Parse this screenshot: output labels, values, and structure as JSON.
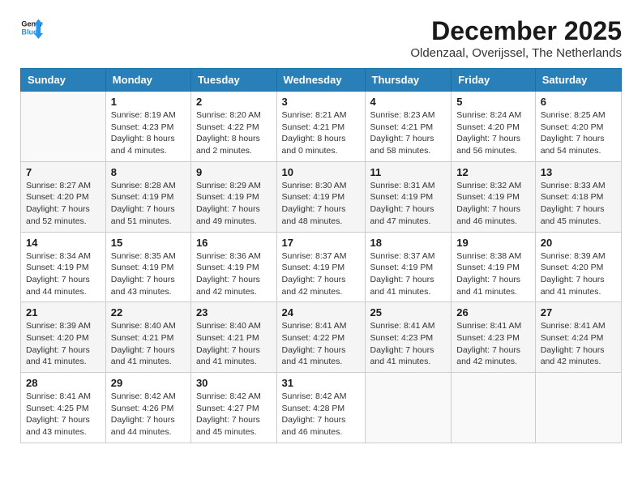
{
  "logo": {
    "line1": "General",
    "line2": "Blue"
  },
  "header": {
    "month": "December 2025",
    "location": "Oldenzaal, Overijssel, The Netherlands"
  },
  "weekdays": [
    "Sunday",
    "Monday",
    "Tuesday",
    "Wednesday",
    "Thursday",
    "Friday",
    "Saturday"
  ],
  "weeks": [
    [
      {
        "day": "",
        "info": ""
      },
      {
        "day": "1",
        "info": "Sunrise: 8:19 AM\nSunset: 4:23 PM\nDaylight: 8 hours\nand 4 minutes."
      },
      {
        "day": "2",
        "info": "Sunrise: 8:20 AM\nSunset: 4:22 PM\nDaylight: 8 hours\nand 2 minutes."
      },
      {
        "day": "3",
        "info": "Sunrise: 8:21 AM\nSunset: 4:21 PM\nDaylight: 8 hours\nand 0 minutes."
      },
      {
        "day": "4",
        "info": "Sunrise: 8:23 AM\nSunset: 4:21 PM\nDaylight: 7 hours\nand 58 minutes."
      },
      {
        "day": "5",
        "info": "Sunrise: 8:24 AM\nSunset: 4:20 PM\nDaylight: 7 hours\nand 56 minutes."
      },
      {
        "day": "6",
        "info": "Sunrise: 8:25 AM\nSunset: 4:20 PM\nDaylight: 7 hours\nand 54 minutes."
      }
    ],
    [
      {
        "day": "7",
        "info": "Sunrise: 8:27 AM\nSunset: 4:20 PM\nDaylight: 7 hours\nand 52 minutes."
      },
      {
        "day": "8",
        "info": "Sunrise: 8:28 AM\nSunset: 4:19 PM\nDaylight: 7 hours\nand 51 minutes."
      },
      {
        "day": "9",
        "info": "Sunrise: 8:29 AM\nSunset: 4:19 PM\nDaylight: 7 hours\nand 49 minutes."
      },
      {
        "day": "10",
        "info": "Sunrise: 8:30 AM\nSunset: 4:19 PM\nDaylight: 7 hours\nand 48 minutes."
      },
      {
        "day": "11",
        "info": "Sunrise: 8:31 AM\nSunset: 4:19 PM\nDaylight: 7 hours\nand 47 minutes."
      },
      {
        "day": "12",
        "info": "Sunrise: 8:32 AM\nSunset: 4:19 PM\nDaylight: 7 hours\nand 46 minutes."
      },
      {
        "day": "13",
        "info": "Sunrise: 8:33 AM\nSunset: 4:18 PM\nDaylight: 7 hours\nand 45 minutes."
      }
    ],
    [
      {
        "day": "14",
        "info": "Sunrise: 8:34 AM\nSunset: 4:19 PM\nDaylight: 7 hours\nand 44 minutes."
      },
      {
        "day": "15",
        "info": "Sunrise: 8:35 AM\nSunset: 4:19 PM\nDaylight: 7 hours\nand 43 minutes."
      },
      {
        "day": "16",
        "info": "Sunrise: 8:36 AM\nSunset: 4:19 PM\nDaylight: 7 hours\nand 42 minutes."
      },
      {
        "day": "17",
        "info": "Sunrise: 8:37 AM\nSunset: 4:19 PM\nDaylight: 7 hours\nand 42 minutes."
      },
      {
        "day": "18",
        "info": "Sunrise: 8:37 AM\nSunset: 4:19 PM\nDaylight: 7 hours\nand 41 minutes."
      },
      {
        "day": "19",
        "info": "Sunrise: 8:38 AM\nSunset: 4:19 PM\nDaylight: 7 hours\nand 41 minutes."
      },
      {
        "day": "20",
        "info": "Sunrise: 8:39 AM\nSunset: 4:20 PM\nDaylight: 7 hours\nand 41 minutes."
      }
    ],
    [
      {
        "day": "21",
        "info": "Sunrise: 8:39 AM\nSunset: 4:20 PM\nDaylight: 7 hours\nand 41 minutes."
      },
      {
        "day": "22",
        "info": "Sunrise: 8:40 AM\nSunset: 4:21 PM\nDaylight: 7 hours\nand 41 minutes."
      },
      {
        "day": "23",
        "info": "Sunrise: 8:40 AM\nSunset: 4:21 PM\nDaylight: 7 hours\nand 41 minutes."
      },
      {
        "day": "24",
        "info": "Sunrise: 8:41 AM\nSunset: 4:22 PM\nDaylight: 7 hours\nand 41 minutes."
      },
      {
        "day": "25",
        "info": "Sunrise: 8:41 AM\nSunset: 4:23 PM\nDaylight: 7 hours\nand 41 minutes."
      },
      {
        "day": "26",
        "info": "Sunrise: 8:41 AM\nSunset: 4:23 PM\nDaylight: 7 hours\nand 42 minutes."
      },
      {
        "day": "27",
        "info": "Sunrise: 8:41 AM\nSunset: 4:24 PM\nDaylight: 7 hours\nand 42 minutes."
      }
    ],
    [
      {
        "day": "28",
        "info": "Sunrise: 8:41 AM\nSunset: 4:25 PM\nDaylight: 7 hours\nand 43 minutes."
      },
      {
        "day": "29",
        "info": "Sunrise: 8:42 AM\nSunset: 4:26 PM\nDaylight: 7 hours\nand 44 minutes."
      },
      {
        "day": "30",
        "info": "Sunrise: 8:42 AM\nSunset: 4:27 PM\nDaylight: 7 hours\nand 45 minutes."
      },
      {
        "day": "31",
        "info": "Sunrise: 8:42 AM\nSunset: 4:28 PM\nDaylight: 7 hours\nand 46 minutes."
      },
      {
        "day": "",
        "info": ""
      },
      {
        "day": "",
        "info": ""
      },
      {
        "day": "",
        "info": ""
      }
    ]
  ]
}
